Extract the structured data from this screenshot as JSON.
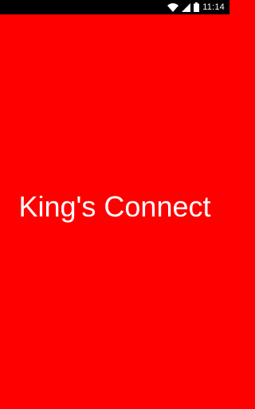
{
  "status_bar": {
    "time": "11:14",
    "icons": [
      "wifi-icon",
      "signal-icon",
      "battery-icon"
    ]
  },
  "splash": {
    "app_name": "King's Connect"
  },
  "colors": {
    "background": "#ff0000",
    "status_bar": "#000000",
    "text": "#ffffff"
  }
}
